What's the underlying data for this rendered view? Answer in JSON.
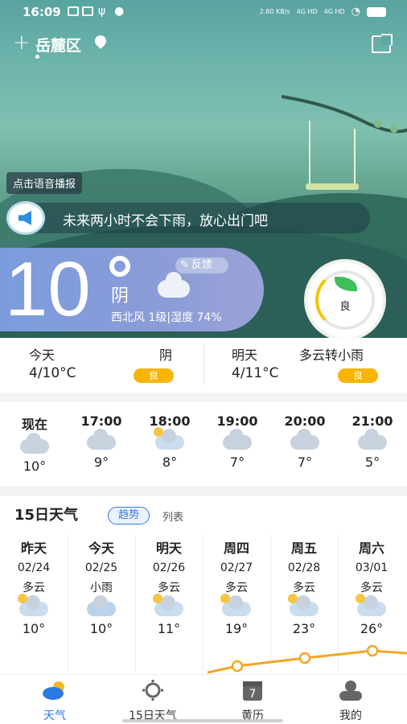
{
  "status_bar": {
    "time": "16:09",
    "net_speed": "2.80 KB/s",
    "signal1": "4G HD",
    "signal2": "4G HD"
  },
  "header": {
    "location": "岳麓区"
  },
  "voice": {
    "tag": "点击语音播报",
    "message": "未来两小时不会下雨，放心出门吧"
  },
  "current": {
    "temp": "10",
    "condition": "阴",
    "wind_humidity": "西北风 1级|湿度 74%",
    "feedback": "反馈",
    "aqi_label": "良"
  },
  "today_summary": [
    {
      "day": "今天",
      "condition": "阴",
      "temp": "4/10°C",
      "aqi": "良"
    },
    {
      "day": "明天",
      "condition": "多云转小雨",
      "temp": "4/11°C",
      "aqi": "良"
    }
  ],
  "hourly": [
    {
      "time": "现在",
      "temp": "10°",
      "icon": "cloud-icon"
    },
    {
      "time": "17:00",
      "temp": "9°",
      "icon": "cloud-icon"
    },
    {
      "time": "18:00",
      "temp": "8°",
      "icon": "partly-cloudy-icon"
    },
    {
      "time": "19:00",
      "temp": "7°",
      "icon": "cloud-icon"
    },
    {
      "time": "20:00",
      "temp": "7°",
      "icon": "cloud-icon"
    },
    {
      "time": "21:00",
      "temp": "5°",
      "icon": "cloud-icon"
    }
  ],
  "forecast": {
    "title": "15日天气",
    "tab_trend": "趋势",
    "tab_list": "列表",
    "days": [
      {
        "weekday": "昨天",
        "date": "02/24",
        "condition": "多云",
        "temp": "10°"
      },
      {
        "weekday": "今天",
        "date": "02/25",
        "condition": "小雨",
        "temp": "10°"
      },
      {
        "weekday": "明天",
        "date": "02/26",
        "condition": "多云",
        "temp": "11°"
      },
      {
        "weekday": "周四",
        "date": "02/27",
        "condition": "多云",
        "temp": "19°"
      },
      {
        "weekday": "周五",
        "date": "02/28",
        "condition": "多云",
        "temp": "23°"
      },
      {
        "weekday": "周六",
        "date": "03/01",
        "condition": "多云",
        "temp": "26°"
      }
    ]
  },
  "nav": [
    {
      "label": "天气",
      "icon": "weather-icon"
    },
    {
      "label": "15日天气",
      "icon": "sun-icon"
    },
    {
      "label": "黄历",
      "icon": "calendar-icon",
      "cal_day": "7"
    },
    {
      "label": "我的",
      "icon": "profile-icon"
    }
  ],
  "colors": {
    "accent": "#2a7ae2",
    "badge": "#f8b400",
    "temp_card": "#8b9cd8"
  }
}
